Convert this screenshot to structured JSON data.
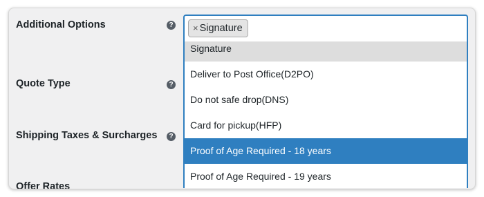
{
  "form": {
    "labels": {
      "additional_options": "Additional Options",
      "quote_type": "Quote Type",
      "shipping_taxes": "Shipping Taxes & Surcharges",
      "offer_rates": "Offer Rates"
    },
    "help_icon": "question-circle-icon",
    "help_glyph": "?"
  },
  "select": {
    "selected_chips": [
      {
        "label": "Signature",
        "remove_glyph": "×"
      }
    ],
    "options": [
      {
        "label": "Signature",
        "state": "selected"
      },
      {
        "label": "Deliver to Post Office(D2PO)",
        "state": "normal"
      },
      {
        "label": "Do not safe drop(DNS)",
        "state": "normal"
      },
      {
        "label": "Card for pickup(HFP)",
        "state": "normal"
      },
      {
        "label": "Proof of Age Required - 18 years",
        "state": "highlighted"
      },
      {
        "label": "Proof of Age Required - 19 years",
        "state": "normal"
      }
    ]
  },
  "colors": {
    "accent": "#2f7fc0",
    "page_background": "#f0f0f1",
    "selected_option_bg": "#dddddd"
  }
}
